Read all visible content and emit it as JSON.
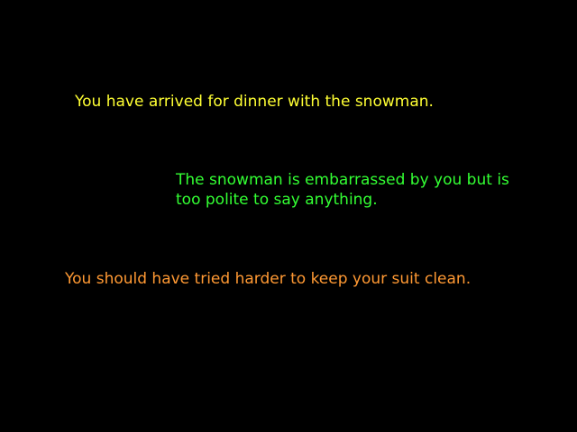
{
  "messages": {
    "arrival": "You have arrived for dinner with the snowman.",
    "snowman": "The snowman is embarrassed by you but is\ntoo polite to say anything.",
    "suit": "You should have tried harder to keep your suit clean."
  },
  "colors": {
    "background": "#000000",
    "arrival": "#ffff33",
    "snowman": "#33ff33",
    "suit": "#ff9933"
  }
}
